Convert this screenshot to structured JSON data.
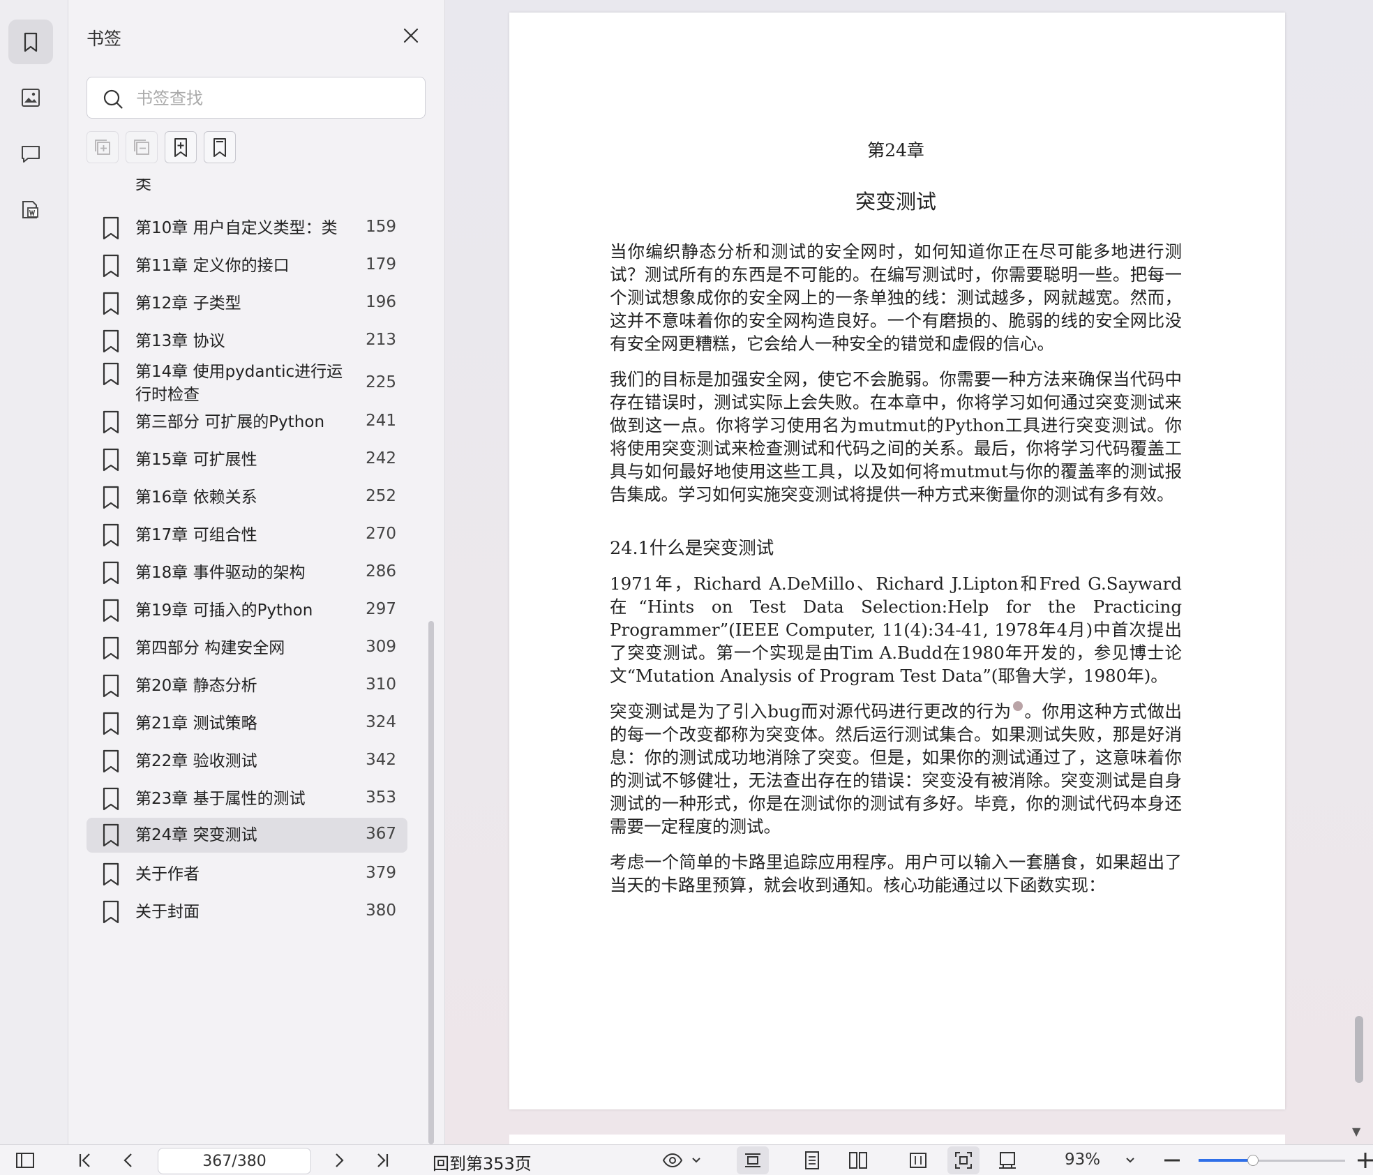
{
  "panel": {
    "title": "书签",
    "search_placeholder": "书签查找"
  },
  "bookmarks": [
    {
      "label": "类",
      "page": ""
    },
    {
      "label": "第10章 用户自定义类型：类",
      "page": "159"
    },
    {
      "label": "第11章 定义你的接口",
      "page": "179"
    },
    {
      "label": "第12章 子类型",
      "page": "196"
    },
    {
      "label": "第13章 协议",
      "page": "213"
    },
    {
      "label": "第14章 使用pydantic进行运行时检查",
      "page": "225"
    },
    {
      "label": "第三部分 可扩展的Python",
      "page": "241"
    },
    {
      "label": "第15章 可扩展性",
      "page": "242"
    },
    {
      "label": "第16章 依赖关系",
      "page": "252"
    },
    {
      "label": "第17章 可组合性",
      "page": "270"
    },
    {
      "label": "第18章 事件驱动的架构",
      "page": "286"
    },
    {
      "label": "第19章 可插入的Python",
      "page": "297"
    },
    {
      "label": "第四部分 构建安全网",
      "page": "309"
    },
    {
      "label": "第20章 静态分析",
      "page": "310"
    },
    {
      "label": "第21章 测试策略",
      "page": "324"
    },
    {
      "label": "第22章 验收测试",
      "page": "342"
    },
    {
      "label": "第23章 基于属性的测试",
      "page": "353"
    },
    {
      "label": "第24章 突变测试",
      "page": "367"
    },
    {
      "label": "关于作者",
      "page": "379"
    },
    {
      "label": "关于封面",
      "page": "380"
    }
  ],
  "active_bookmark_index": 17,
  "document": {
    "chapter_num": "第24章",
    "chapter_title": "突变测试",
    "para1": "当你编织静态分析和测试的安全网时，如何知道你正在尽可能多地进行测试？测试所有的东西是不可能的。在编写测试时，你需要聪明一些。把每一个测试想象成你的安全网上的一条单独的线：测试越多，网就越宽。然而，这并不意味着你的安全网构造良好。一个有磨损的、脆弱的线的安全网比没有安全网更糟糕，它会给人一种安全的错觉和虚假的信心。",
    "para2": "我们的目标是加强安全网，使它不会脆弱。你需要一种方法来确保当代码中存在错误时，测试实际上会失败。在本章中，你将学习如何通过突变测试来做到这一点。你将学习使用名为mutmut的Python工具进行突变测试。你将使用突变测试来检查测试和代码之间的关系。最后，你将学习代码覆盖工具与如何最好地使用这些工具，以及如何将mutmut与你的覆盖率的测试报告集成。学习如何实施突变测试将提供一种方式来衡量你的测试有多有效。",
    "section_head": "24.1什么是突变测试",
    "para3": "1971年，Richard A.DeMillo、Richard J.Lipton和Fred G.Sayward在“Hints on Test Data Selection:Help for the Practicing Programmer”(IEEE Computer, 11(4):34-41, 1978年4月)中首次提出了突变测试。第一个实现是由Tim A.Budd在1980年开发的，参见博士论文“Mutation Analysis of Program Test Data”(耶鲁大学，1980年)。",
    "para4a": "突变测试是为了引入bug而对源代码进行更改的行为",
    "para4b": "。你用这种方式做出的每一个改变都称为突变体。然后运行测试集合。如果测试失败，那是好消息：你的测试成功地消除了突变。但是，如果你的测试通过了，这意味着你的测试不够健壮，无法查出存在的错误：突变没有被消除。突变测试是自身测试的一种形式，你是在测试你的测试有多好。毕竟，你的测试代码本身还需要一定程度的测试。",
    "para5": "考虑一个简单的卡路里追踪应用程序。用户可以输入一套膳食，如果超出了当天的卡路里预算，就会收到通知。核心功能通过以下函数实现："
  },
  "toolbar": {
    "page_value": "367/380",
    "back_label": "回到第353页",
    "zoom_label": "93%",
    "zoom_fraction": 0.37
  },
  "colors": {
    "accent": "#2f6fe8",
    "active_row": "#dfdee3"
  }
}
